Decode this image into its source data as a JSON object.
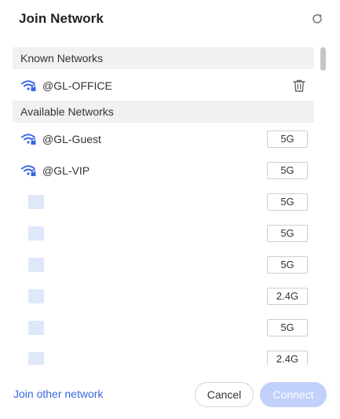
{
  "dialog": {
    "title": "Join Network"
  },
  "known": {
    "header": "Known Networks",
    "networks": [
      {
        "ssid": "@GL-OFFICE"
      }
    ]
  },
  "available": {
    "header": "Available Networks",
    "networks": [
      {
        "ssid": "@GL-Guest",
        "band": "5G"
      },
      {
        "ssid": "@GL-VIP",
        "band": "5G"
      },
      {
        "ssid": "",
        "band": "5G"
      },
      {
        "ssid": "",
        "band": "5G"
      },
      {
        "ssid": "",
        "band": "5G"
      },
      {
        "ssid": "",
        "band": "2.4G"
      },
      {
        "ssid": "",
        "band": "5G"
      },
      {
        "ssid": "",
        "band": "2.4G"
      }
    ]
  },
  "footer": {
    "join_other": "Join other network",
    "cancel": "Cancel",
    "connect": "Connect"
  },
  "colors": {
    "accent": "#3b67e0",
    "connect_disabled": "#c2d1fb",
    "section_bg": "#f1f1f1",
    "placeholder_block": "#dfe7fa"
  },
  "icons": {
    "refresh": "refresh-icon",
    "secured_wifi": "wifi-lock-icon",
    "delete": "trash-icon"
  }
}
